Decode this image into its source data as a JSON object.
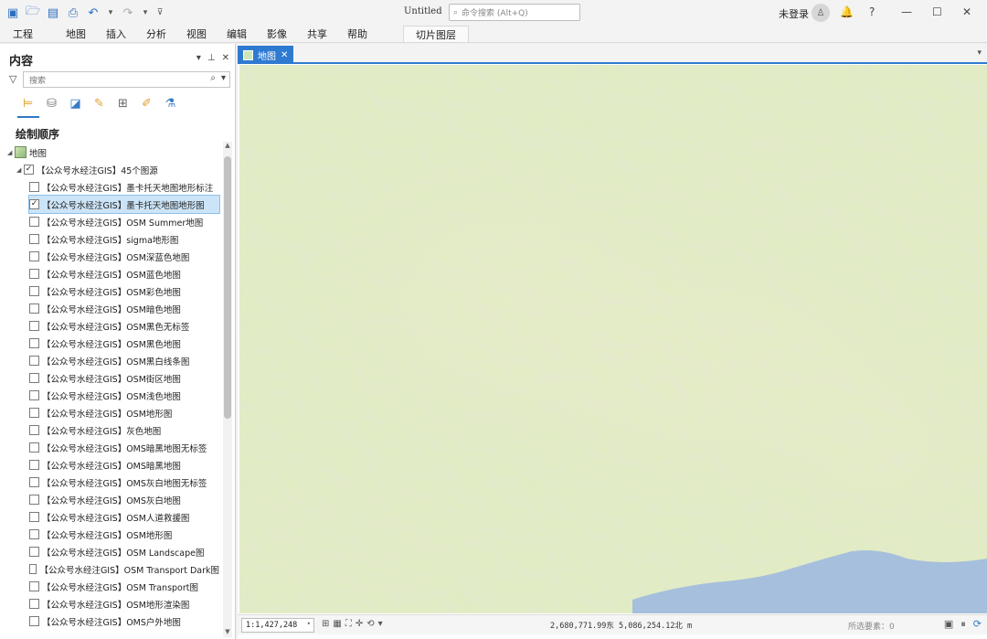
{
  "window": {
    "title": "Untitled",
    "command_search_placeholder": "命令搜索 (Alt+Q)",
    "account_status": "未登录",
    "help": "?"
  },
  "ribbon": {
    "tabs": [
      "工程",
      "地图",
      "插入",
      "分析",
      "视图",
      "编辑",
      "影像",
      "共享",
      "帮助"
    ],
    "contextual_tab": "切片图层"
  },
  "contents": {
    "title": "内容",
    "search_placeholder": "搜索",
    "drawing_order": "绘制顺序",
    "map_name": "地图",
    "group_name": "【公众号水经注GIS】45个图源",
    "layers": [
      {
        "name": "【公众号水经注GIS】墨卡托天地图地形标注",
        "checked": false,
        "selected": false
      },
      {
        "name": "【公众号水经注GIS】墨卡托天地图地形图",
        "checked": true,
        "selected": true
      },
      {
        "name": "【公众号水经注GIS】OSM Summer地图",
        "checked": false,
        "selected": false
      },
      {
        "name": "【公众号水经注GIS】sigma地形图",
        "checked": false,
        "selected": false
      },
      {
        "name": "【公众号水经注GIS】OSM深蓝色地图",
        "checked": false,
        "selected": false
      },
      {
        "name": "【公众号水经注GIS】OSM蓝色地图",
        "checked": false,
        "selected": false
      },
      {
        "name": "【公众号水经注GIS】OSM彩色地图",
        "checked": false,
        "selected": false
      },
      {
        "name": "【公众号水经注GIS】OSM暗色地图",
        "checked": false,
        "selected": false
      },
      {
        "name": "【公众号水经注GIS】OSM黑色无标签",
        "checked": false,
        "selected": false
      },
      {
        "name": "【公众号水经注GIS】OSM黑色地图",
        "checked": false,
        "selected": false
      },
      {
        "name": "【公众号水经注GIS】OSM黑白线条图",
        "checked": false,
        "selected": false
      },
      {
        "name": "【公众号水经注GIS】OSM街区地图",
        "checked": false,
        "selected": false
      },
      {
        "name": "【公众号水经注GIS】OSM浅色地图",
        "checked": false,
        "selected": false
      },
      {
        "name": "【公众号水经注GIS】OSM地形图",
        "checked": false,
        "selected": false
      },
      {
        "name": "【公众号水经注GIS】灰色地图",
        "checked": false,
        "selected": false
      },
      {
        "name": "【公众号水经注GIS】OMS暗黑地图无标签",
        "checked": false,
        "selected": false
      },
      {
        "name": "【公众号水经注GIS】OMS暗黑地图",
        "checked": false,
        "selected": false
      },
      {
        "name": "【公众号水经注GIS】OMS灰白地图无标签",
        "checked": false,
        "selected": false
      },
      {
        "name": "【公众号水经注GIS】OMS灰白地图",
        "checked": false,
        "selected": false
      },
      {
        "name": "【公众号水经注GIS】OSM人道救援图",
        "checked": false,
        "selected": false
      },
      {
        "name": "【公众号水经注GIS】OSM地形图",
        "checked": false,
        "selected": false
      },
      {
        "name": "【公众号水经注GIS】OSM Landscape图",
        "checked": false,
        "selected": false
      },
      {
        "name": "【公众号水经注GIS】OSM Transport Dark图",
        "checked": false,
        "selected": false
      },
      {
        "name": "【公众号水经注GIS】OSM Transport图",
        "checked": false,
        "selected": false
      },
      {
        "name": "【公众号水经注GIS】OSM地形渲染图",
        "checked": false,
        "selected": false
      },
      {
        "name": "【公众号水经注GIS】OMS户外地图",
        "checked": false,
        "selected": false
      }
    ]
  },
  "map_view": {
    "tab_label": "地图",
    "scale": "1:1,427,248",
    "coordinates": "2,680,771.99东 5,086,254.12北 m",
    "selected_features": "所选要素：0"
  },
  "colors": {
    "accent": "#2e7ad1",
    "terrain_low": "#d9eec8",
    "terrain_high": "#f1ebd2",
    "water": "#a6bfdc"
  }
}
